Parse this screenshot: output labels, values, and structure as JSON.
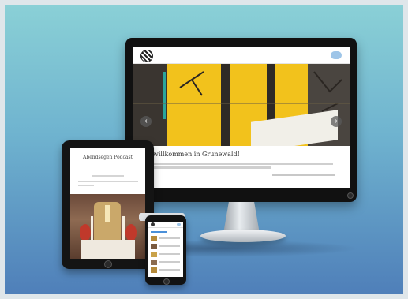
{
  "monitor": {
    "welcome_title": "willkommen in Grunewald!",
    "prev_arrow": "‹",
    "next_arrow": "›"
  },
  "tablet": {
    "title": "Abendsegen Podcast"
  },
  "colors": {
    "background_top": "#8ad0d6",
    "background_bottom": "#4f7fb9",
    "hero_yellow": "#f2c21c",
    "menu_button": "#9ec5e8",
    "accent_teal": "#2aa59b"
  }
}
